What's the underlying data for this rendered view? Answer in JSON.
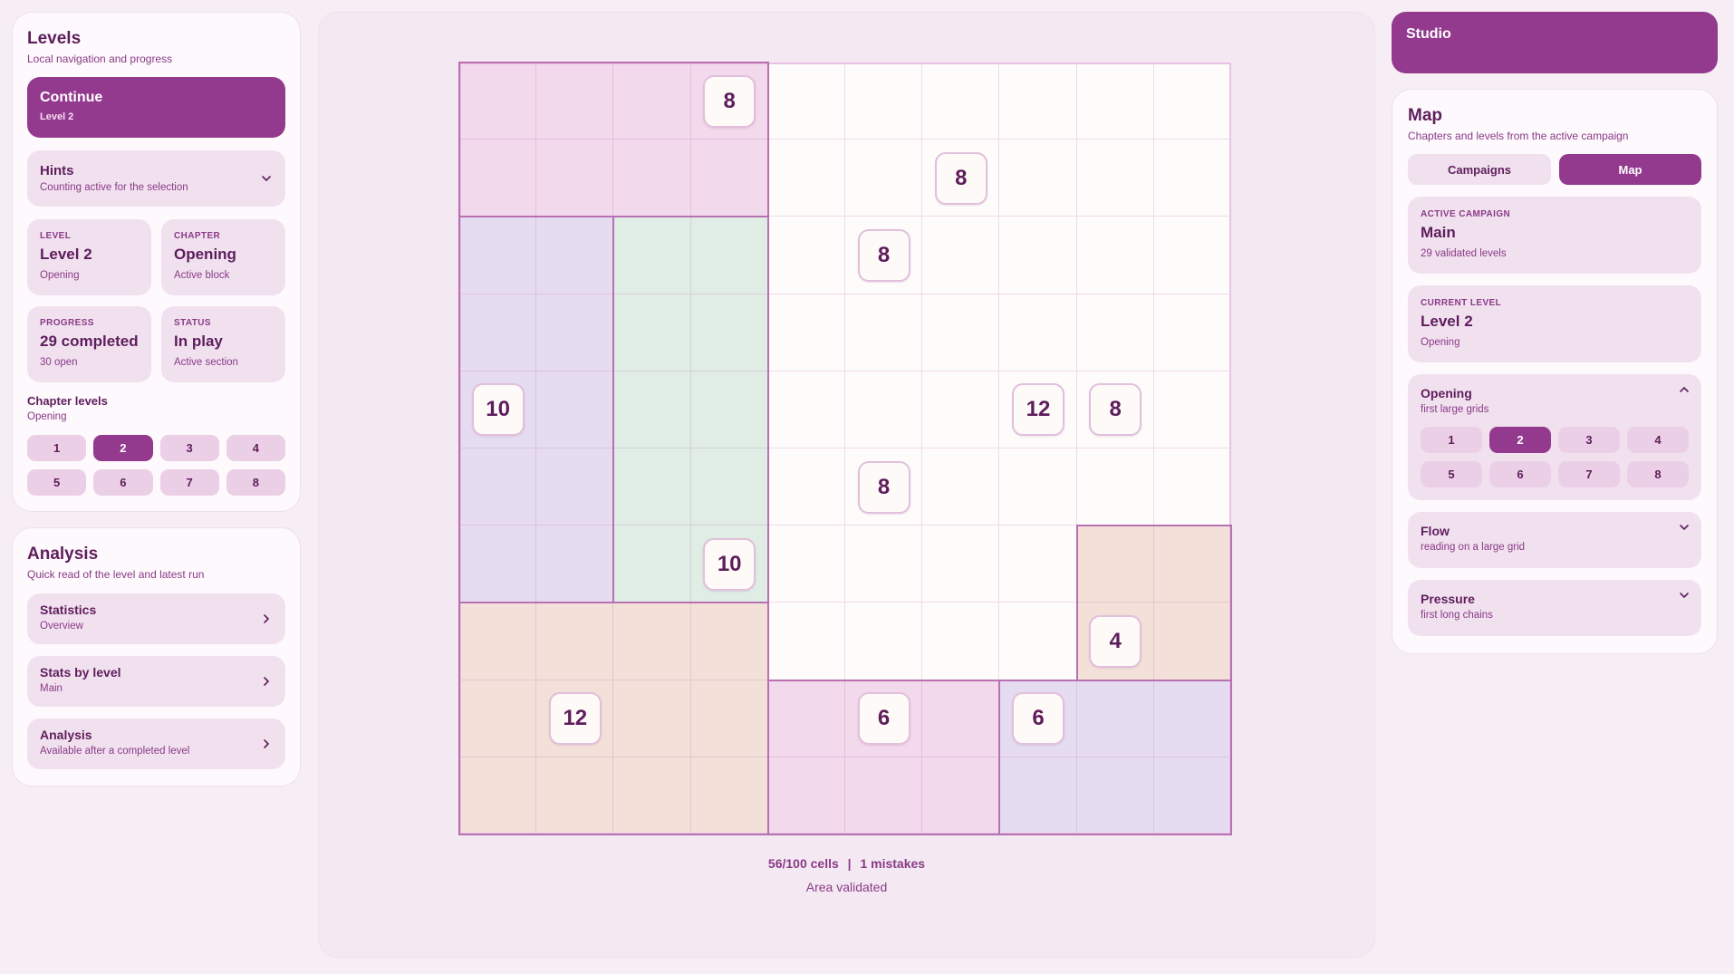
{
  "levels": {
    "title": "Levels",
    "subtitle": "Local navigation and progress",
    "continue": {
      "label": "Continue",
      "sub": "Level 2"
    },
    "hints": {
      "label": "Hints",
      "sub": "Counting active for the selection"
    },
    "level_card": {
      "eyebrow": "LEVEL",
      "value": "Level 2",
      "sub": "Opening"
    },
    "chapter_card": {
      "eyebrow": "CHAPTER",
      "value": "Opening",
      "sub": "Active block"
    },
    "progress_card": {
      "eyebrow": "PROGRESS",
      "value": "29 completed",
      "sub": "30 open"
    },
    "status_card": {
      "eyebrow": "STATUS",
      "value": "In play",
      "sub": "Active section"
    },
    "chapter_levels": {
      "title": "Chapter levels",
      "sub": "Opening",
      "items": [
        "1",
        "2",
        "3",
        "4",
        "5",
        "6",
        "7",
        "8"
      ],
      "active": "2"
    }
  },
  "analysis": {
    "title": "Analysis",
    "subtitle": "Quick read of the level and latest run",
    "items": [
      {
        "label": "Statistics",
        "sub": "Overview"
      },
      {
        "label": "Stats by level",
        "sub": "Main"
      },
      {
        "label": "Analysis",
        "sub": "Available after a completed level"
      }
    ]
  },
  "board": {
    "size": 10,
    "regions": [
      {
        "r": 0,
        "c": 0,
        "h": 2,
        "w": 4,
        "color": "#f3d9ec"
      },
      {
        "r": 2,
        "c": 0,
        "h": 5,
        "w": 2,
        "color": "#e6dcf1"
      },
      {
        "r": 2,
        "c": 2,
        "h": 5,
        "w": 2,
        "color": "#dfede5"
      },
      {
        "r": 7,
        "c": 0,
        "h": 3,
        "w": 4,
        "color": "#f3e1d9"
      },
      {
        "r": 8,
        "c": 4,
        "h": 2,
        "w": 3,
        "color": "#f3d9ec"
      },
      {
        "r": 8,
        "c": 7,
        "h": 2,
        "w": 3,
        "color": "#e6dcf1"
      },
      {
        "r": 6,
        "c": 8,
        "h": 2,
        "w": 2,
        "color": "#f3e1d9"
      }
    ],
    "clues": [
      {
        "r": 0,
        "c": 3,
        "v": "8"
      },
      {
        "r": 1,
        "c": 6,
        "v": "8"
      },
      {
        "r": 2,
        "c": 5,
        "v": "8"
      },
      {
        "r": 4,
        "c": 0,
        "v": "10"
      },
      {
        "r": 4,
        "c": 7,
        "v": "12"
      },
      {
        "r": 4,
        "c": 8,
        "v": "8"
      },
      {
        "r": 5,
        "c": 5,
        "v": "8"
      },
      {
        "r": 6,
        "c": 3,
        "v": "10"
      },
      {
        "r": 7,
        "c": 8,
        "v": "4"
      },
      {
        "r": 8,
        "c": 1,
        "v": "12"
      },
      {
        "r": 8,
        "c": 5,
        "v": "6"
      },
      {
        "r": 8,
        "c": 7,
        "v": "6"
      }
    ],
    "status_cells": "56/100 cells",
    "separator": "|",
    "status_mistakes": "1 mistakes",
    "status_message": "Area validated"
  },
  "studio": {
    "title": "Studio"
  },
  "map": {
    "title": "Map",
    "subtitle": "Chapters and levels from the active campaign",
    "tabs": [
      {
        "label": "Campaigns",
        "active": false
      },
      {
        "label": "Map",
        "active": true
      }
    ],
    "active_campaign": {
      "eyebrow": "ACTIVE CAMPAIGN",
      "value": "Main",
      "sub": "29 validated levels"
    },
    "current_level": {
      "eyebrow": "CURRENT LEVEL",
      "value": "Level 2",
      "sub": "Opening"
    },
    "chapters": [
      {
        "label": "Opening",
        "sub": "first large grids",
        "expanded": true,
        "levels": [
          "1",
          "2",
          "3",
          "4",
          "5",
          "6",
          "7",
          "8"
        ],
        "active": "2"
      },
      {
        "label": "Flow",
        "sub": "reading on a large grid",
        "expanded": false
      },
      {
        "label": "Pressure",
        "sub": "first long chains",
        "expanded": false
      }
    ]
  },
  "colors": {
    "accent": "#933a8e",
    "card": "#f1e1ef",
    "text": "#5e1d5c"
  }
}
